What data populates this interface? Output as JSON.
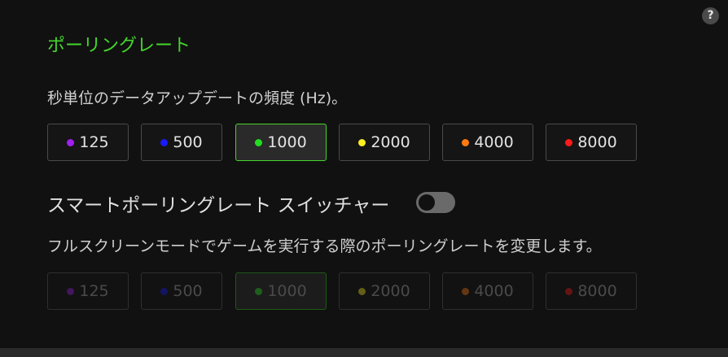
{
  "help": {
    "icon": "help-icon",
    "label": "?"
  },
  "title": "ポーリングレート",
  "description": "秒単位のデータアップデートの頻度 (Hz)。",
  "rates": [
    {
      "label": "125",
      "color": "#a020f0",
      "selected": false
    },
    {
      "label": "500",
      "color": "#1a1aff",
      "selected": false
    },
    {
      "label": "1000",
      "color": "#22dd22",
      "selected": true
    },
    {
      "label": "2000",
      "color": "#ffee22",
      "selected": false
    },
    {
      "label": "4000",
      "color": "#ff7a10",
      "selected": false
    },
    {
      "label": "8000",
      "color": "#ff1a1a",
      "selected": false
    }
  ],
  "switcher": {
    "label": "スマートポーリングレート スイッチャー",
    "enabled": false
  },
  "switcher_description": "フルスクリーンモードでゲームを実行する際のポーリングレートを変更します。",
  "fullscreen_rates": [
    {
      "label": "125",
      "color": "#a020f0",
      "selected": false
    },
    {
      "label": "500",
      "color": "#1a1aff",
      "selected": false
    },
    {
      "label": "1000",
      "color": "#22dd22",
      "selected": true
    },
    {
      "label": "2000",
      "color": "#ffee22",
      "selected": false
    },
    {
      "label": "4000",
      "color": "#ff7a10",
      "selected": false
    },
    {
      "label": "8000",
      "color": "#ff1a1a",
      "selected": false
    }
  ],
  "accent_color": "#44d62c"
}
